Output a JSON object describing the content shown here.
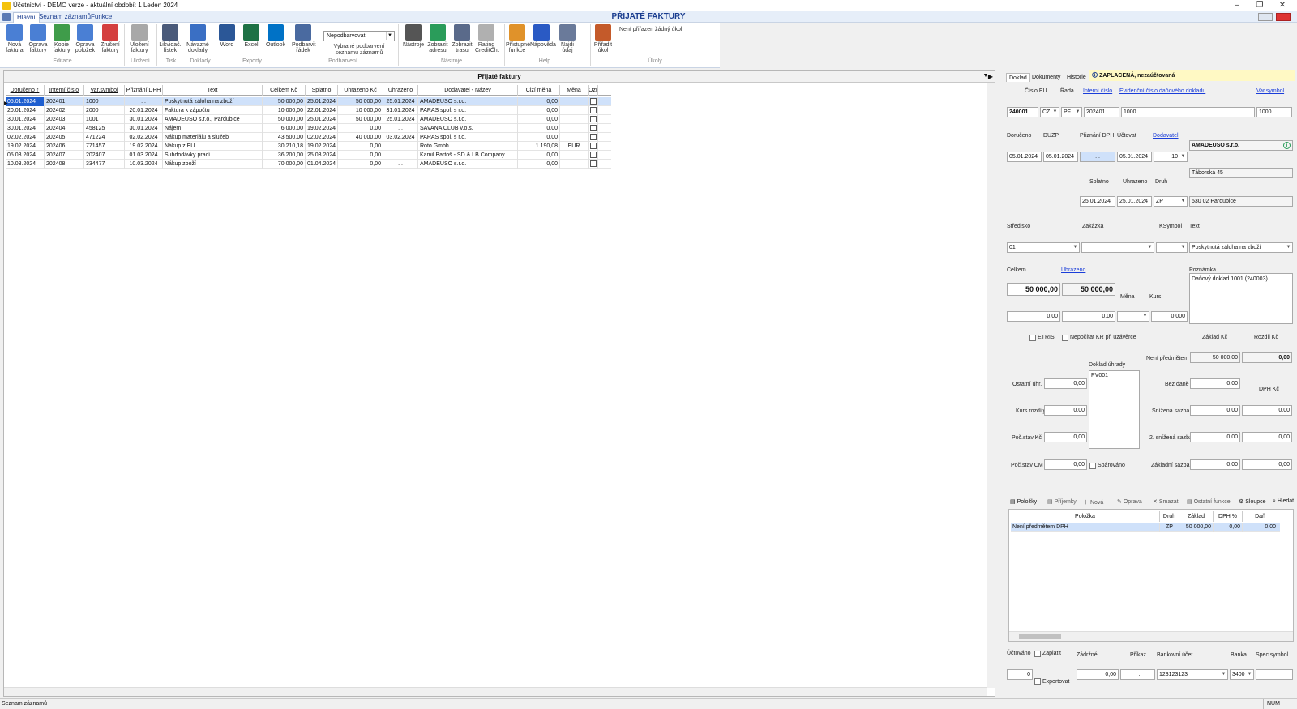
{
  "window": {
    "title": "Účetnictví - DEMO verze - aktuální období: 1 Leden 2024",
    "minimize": "–",
    "maximize": "❐",
    "close": "✕"
  },
  "menu": {
    "tabs": [
      "Hlavní",
      "Seznam záznamů",
      "Funkce"
    ]
  },
  "app_title": "PŘIJATÉ FAKTURY",
  "ribbon": {
    "buttons": [
      {
        "l1": "Nová",
        "l2": "faktura",
        "icon": "new-invoice-icon",
        "color": "#4a7fd4"
      },
      {
        "l1": "Oprava",
        "l2": "faktury",
        "icon": "edit-invoice-icon",
        "color": "#4a7fd4"
      },
      {
        "l1": "Kopie",
        "l2": "faktury",
        "icon": "copy-invoice-icon",
        "color": "#3f9c4a"
      },
      {
        "l1": "Oprava",
        "l2": "položek",
        "icon": "edit-items-icon",
        "color": "#4a7fd4"
      },
      {
        "l1": "Zrušení",
        "l2": "faktury",
        "icon": "cancel-invoice-icon",
        "color": "#d43f3f"
      },
      {
        "l1": "Uložení",
        "l2": "faktury",
        "icon": "save-icon",
        "color": "#a8a8a8"
      },
      {
        "l1": "Likvidač.",
        "l2": "lístek",
        "icon": "printer-icon",
        "color": "#4a5a7a"
      },
      {
        "l1": "Návazné",
        "l2": "doklady",
        "icon": "chain-link-icon",
        "color": "#3a6fc4"
      },
      {
        "l1": "Word",
        "l2": "",
        "icon": "word-icon",
        "color": "#2b5797"
      },
      {
        "l1": "Excel",
        "l2": "",
        "icon": "excel-icon",
        "color": "#1e7145"
      },
      {
        "l1": "Outlook",
        "l2": "",
        "icon": "outlook-icon",
        "color": "#0072c6"
      },
      {
        "l1": "Podbarvit",
        "l2": "řádek",
        "icon": "paint-brush-icon",
        "color": "#4a6aa0"
      },
      {
        "l1": "Nástroje",
        "l2": "",
        "icon": "gear-icon",
        "color": "#555555"
      },
      {
        "l1": "Zobrazit",
        "l2": "adresu",
        "icon": "map-pin-icon",
        "color": "#2a9c5a"
      },
      {
        "l1": "Zobrazit",
        "l2": "trasu",
        "icon": "globe-icon",
        "color": "#5a6a8a"
      },
      {
        "l1": "Rating",
        "l2": "CreditCh.",
        "icon": "help-circle-icon",
        "color": "#b0b0b0"
      },
      {
        "l1": "Přístupné",
        "l2": "funkce",
        "icon": "scroll-icon",
        "color": "#e0922a"
      },
      {
        "l1": "Nápověda",
        "l2": "",
        "icon": "question-icon",
        "color": "#2a5ac4"
      },
      {
        "l1": "Najdi údaj",
        "l2": "",
        "icon": "magnifier-icon",
        "color": "#6a7a9a"
      },
      {
        "l1": "Přiřadit",
        "l2": "úkol",
        "icon": "task-check-icon",
        "color": "#c45a2a"
      }
    ],
    "groups": [
      "Editace",
      "Uložení",
      "Tisk",
      "Doklady",
      "Exporty",
      "Podbarvení",
      "Nástroje",
      "Help",
      "Úkoly"
    ],
    "color_select": "Nepodbarvovat",
    "color_select_caption_1": "Vybrané podbarvení",
    "color_select_caption_2": "seznamu záznamů",
    "task_text": "Není přiřazen žádný úkol"
  },
  "list": {
    "title": "Přijaté faktury",
    "columns": [
      "Doručeno ↑",
      "Interní číslo",
      "Var.symbol",
      "Přiznání DPH",
      "Text",
      "Celkem Kč",
      "Splatno",
      "Uhrazeno Kč",
      "Uhrazeno",
      "Dodavatel - Název",
      "Cizí měna",
      "Měna",
      "Ozn"
    ],
    "rows": [
      [
        "05.01.2024",
        "202401",
        "1000",
        ". .",
        "Poskytnutá záloha na zboží",
        "50 000,00",
        "25.01.2024",
        "50 000,00",
        "25.01.2024",
        "AMADEUSO s.r.o.",
        "0,00",
        ""
      ],
      [
        "20.01.2024",
        "202402",
        "2000",
        "20.01.2024",
        "Faktura k zápočtu",
        "10 000,00",
        "22.01.2024",
        "10 000,00",
        "31.01.2024",
        "PARAS spol. s r.o.",
        "0,00",
        ""
      ],
      [
        "30.01.2024",
        "202403",
        "1001",
        "30.01.2024",
        "AMADEUSO s.r.o., Pardubice",
        "50 000,00",
        "25.01.2024",
        "50 000,00",
        "25.01.2024",
        "AMADEUSO s.r.o.",
        "0,00",
        ""
      ],
      [
        "30.01.2024",
        "202404",
        "458125",
        "30.01.2024",
        "Nájem",
        "6 000,00",
        "19.02.2024",
        "0,00",
        ". .",
        "SAVANA CLUB v.o.s.",
        "0,00",
        ""
      ],
      [
        "02.02.2024",
        "202405",
        "471224",
        "02.02.2024",
        "Nákup materiálu a služeb",
        "43 500,00",
        "02.02.2024",
        "40 000,00",
        "03.02.2024",
        "PARAS spol. s r.o.",
        "0,00",
        ""
      ],
      [
        "19.02.2024",
        "202406",
        "771457",
        "19.02.2024",
        "Nákup z EU",
        "30 210,18",
        "19.02.2024",
        "0,00",
        ". .",
        "Roto Gmbh.",
        "1 190,08",
        "EUR"
      ],
      [
        "05.03.2024",
        "202407",
        "202407",
        "01.03.2024",
        "Subdodávky prací",
        "36 200,00",
        "25.03.2024",
        "0,00",
        ". .",
        "Kamil Bartoš - SD & LB Company",
        "0,00",
        ""
      ],
      [
        "10.03.2024",
        "202408",
        "334477",
        "10.03.2024",
        "Nákup zboží",
        "70 000,00",
        "01.04.2024",
        "0,00",
        ". .",
        "AMADEUSO s.r.o.",
        "0,00",
        ""
      ]
    ]
  },
  "detail": {
    "tabs": [
      "Doklad",
      "Dokumenty",
      "Historie"
    ],
    "status": "ZAPLACENÁ, nezaúčtovaná",
    "labels": {
      "cislo_eu": "Číslo EU",
      "rada": "Řada",
      "interni_cislo": "Interní číslo",
      "evidencni": "Evidenční číslo daňového dokladu",
      "var_symbol": "Var.symbol",
      "doruceno": "Doručeno",
      "duzp": "DUZP",
      "priznani_dph": "Přiznání DPH",
      "uctovat": "Účtovat",
      "dodavatel": "Dodavatel",
      "splatno": "Splatno",
      "uhrazeno": "Uhrazeno",
      "druh": "Druh",
      "stredisko": "Středisko",
      "zakazka": "Zakázka",
      "ksymbol": "KSymbol",
      "text": "Text",
      "celkem": "Celkem",
      "uhrazeno_link": "Uhrazeno",
      "poznamka": "Poznámka",
      "mena": "Měna",
      "kurs": "Kurs",
      "etris": "ETRIS",
      "nepocitat": "Nepočítat KR při uzávěrce",
      "zaklad_kc": "Základ Kč",
      "rozdil_kc": "Rozdíl Kč",
      "neni_predmetem": "Není předmětem",
      "doklad_uhrady": "Doklad úhrady",
      "ostatni_uhr": "Ostatní úhr.",
      "bez_dane": "Bez daně",
      "dph_kc": "DPH Kč",
      "kurs_rozdily": "Kurs.rozdíly",
      "snizena": "Snížená sazba",
      "poc_stav_kc": "Poč.stav Kč",
      "snizena2": "2. snížená sazba",
      "poc_stav_cm": "Poč.stav CM",
      "sparovano": "Spárováno",
      "zakladni": "Základní sazba"
    },
    "values": {
      "cislo": "240001",
      "stat": "CZ",
      "rada": "PF",
      "interni": "202401",
      "evidencni": "1000",
      "var_symbol": "1000",
      "doruceno": "05.01.2024",
      "duzp": "05.01.2024",
      "priznani": ". .",
      "uctovat": "05.01.2024",
      "ucet": "10",
      "dodavatel_nazev": "AMADEUSO s.r.o.",
      "dodavatel_ulice": "Táborská 45",
      "dodavatel_mesto": "530 02 Pardubice",
      "splatno": "25.01.2024",
      "uhrazeno": "25.01.2024",
      "druh": "ZP",
      "stredisko": "01",
      "zakazka": "",
      "ksymbol": "",
      "text": "Poskytnutá záloha na zboží",
      "celkem": "50 000,00",
      "uhrazeno_castka": "50 000,00",
      "poznamka": "Daňový doklad 1001 (240003)",
      "celkem_cm": "0,00",
      "uhrazeno_cm": "0,00",
      "mena": "",
      "kurs": "0,000",
      "neni_zaklad": "50 000,00",
      "neni_rozdil": "0,00",
      "doklad_uhrady": "PV001",
      "ostatni_uhr": "0,00",
      "bez_dane": "0,00",
      "kurs_rozdily": "0,00",
      "snizena_zaklad": "0,00",
      "snizena_dph": "0,00",
      "poc_stav_kc": "0,00",
      "snizena2_zaklad": "0,00",
      "snizena2_dph": "0,00",
      "poc_stav_cm": "0,00",
      "zakladni_zaklad": "0,00",
      "zakladni_dph": "0,00"
    },
    "items_toolbar": [
      "Položky",
      "Příjemky",
      "Nová",
      "Oprava",
      "Smazat",
      "Ostatní funkce",
      "Sloupce",
      "Hledat"
    ],
    "items_columns": [
      "Položka",
      "Druh",
      "Základ",
      "DPH %",
      "Daň"
    ],
    "items_rows": [
      [
        "Není předmětem DPH",
        "ZP",
        "50 000,00",
        "0,00",
        "0,00"
      ]
    ],
    "bottom": {
      "uctovano": "Účtováno",
      "zaplatit": "Zaplatit",
      "zadrzne": "Zádržné",
      "prikaz": "Příkaz",
      "bankovni_ucet": "Bankovní účet",
      "banka": "Banka",
      "spec_symbol": "Spec.symbol",
      "uctovano_val": "0",
      "exportovat": "Exportovat",
      "zadrzne_val": "0,00",
      "prikaz_val": ". .",
      "bankovni_ucet_val": "123123123",
      "banka_val": "3400",
      "spec_symbol_val": ""
    }
  },
  "statusbar": {
    "left": "Seznam záznamů",
    "num": "NUM"
  }
}
